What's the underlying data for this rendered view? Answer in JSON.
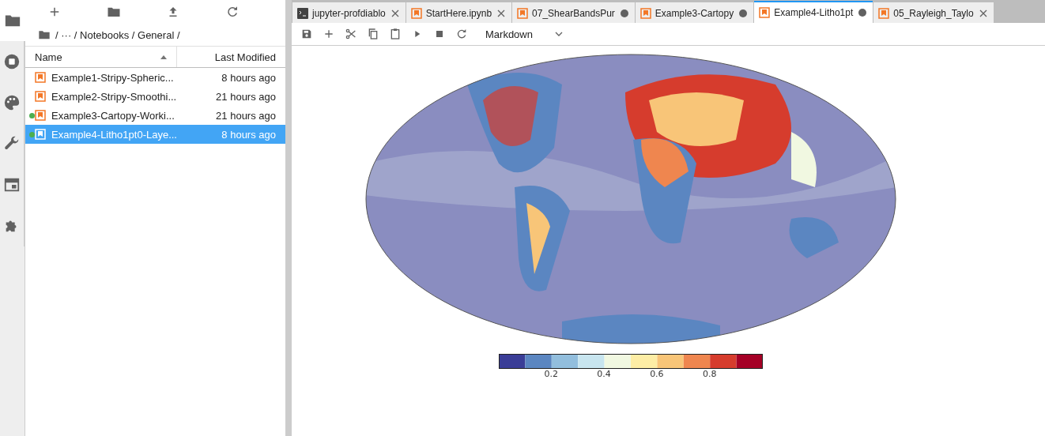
{
  "activity_bar": {
    "items": [
      {
        "kind": "folder",
        "selected": true
      },
      {
        "kind": "running",
        "selected": false
      },
      {
        "kind": "palette",
        "selected": false
      },
      {
        "kind": "wrench",
        "selected": false
      },
      {
        "kind": "tabs",
        "selected": false
      },
      {
        "kind": "puzzle",
        "selected": false
      }
    ]
  },
  "file_browser": {
    "toolbar": [
      {
        "kind": "new"
      },
      {
        "kind": "folder"
      },
      {
        "kind": "upload"
      },
      {
        "kind": "refresh"
      }
    ],
    "path": "/ ··· / Notebooks / General /",
    "columns": [
      "Name",
      "Last Modified"
    ],
    "files": [
      {
        "name": "Example1-Stripy-Spheric...",
        "modified": "8 hours ago",
        "running": false,
        "selected": false
      },
      {
        "name": "Example2-Stripy-Smoothi...",
        "modified": "21 hours ago",
        "running": false,
        "selected": false
      },
      {
        "name": "Example3-Cartopy-Worki...",
        "modified": "21 hours ago",
        "running": true,
        "selected": false
      },
      {
        "name": "Example4-Litho1pt0-Laye...",
        "modified": "8 hours ago",
        "running": true,
        "selected": true
      }
    ]
  },
  "tabs": [
    {
      "kind": "terminal",
      "label": "jupyter-profdiablo",
      "dirty": false,
      "selected": false
    },
    {
      "kind": "notebook",
      "label": "StartHere.ipynb",
      "dirty": false,
      "selected": false
    },
    {
      "kind": "notebook",
      "label": "07_ShearBandsPur",
      "dirty": true,
      "selected": false
    },
    {
      "kind": "notebook",
      "label": "Example3-Cartopy",
      "dirty": true,
      "selected": false
    },
    {
      "kind": "notebook",
      "label": "Example4-Litho1pt",
      "dirty": true,
      "selected": true
    },
    {
      "kind": "notebook",
      "label": "05_Rayleigh_Taylo",
      "dirty": false,
      "selected": false
    }
  ],
  "notebook_toolbar": {
    "buttons": [
      {
        "kind": "save"
      },
      {
        "kind": "add"
      },
      {
        "kind": "cut"
      },
      {
        "kind": "copy"
      },
      {
        "kind": "paste"
      },
      {
        "kind": "run"
      },
      {
        "kind": "stop"
      },
      {
        "kind": "restart"
      }
    ],
    "cell_type": "Markdown"
  },
  "colorbar": {
    "ticks": [
      "0.2",
      "0.4",
      "0.6",
      "0.8"
    ]
  }
}
